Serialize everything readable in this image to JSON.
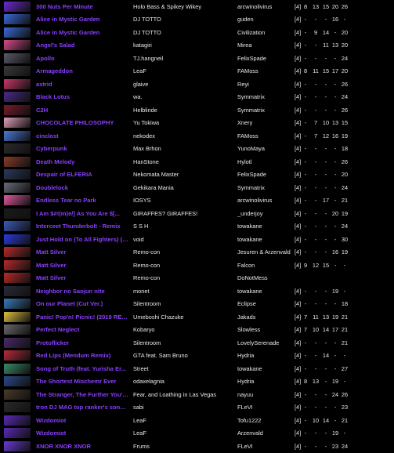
{
  "songs": [
    {
      "title": "300 Nuts Per Minute",
      "artist": "Holo Bass & Spikey Wikey",
      "charter": "arcwinolivirus",
      "level": "[4]",
      "d": [
        "8",
        "13",
        "15",
        "20",
        "26"
      ],
      "thumb": "#6a2bd0"
    },
    {
      "title": "Alice in Mystic Garden",
      "artist": "DJ TOTTO",
      "charter": "guden",
      "level": "[4]",
      "d": [
        "-",
        "-",
        "-",
        "16",
        "-"
      ],
      "thumb": "#3a6ad8"
    },
    {
      "title": "Alice in Mystic Garden",
      "artist": "DJ TOTTO",
      "charter": "Civilization",
      "level": "[4]",
      "d": [
        "-",
        "9",
        "14",
        "-",
        "20"
      ],
      "thumb": "#3a6ad8"
    },
    {
      "title": "Angel's Salad",
      "artist": "katagiri",
      "charter": "Mirea",
      "level": "[4]",
      "d": [
        "-",
        "-",
        "11",
        "13",
        "20"
      ],
      "thumb": "#d84a8a"
    },
    {
      "title": "Apollo",
      "artist": "TJ.hangneil",
      "charter": "FelixSpade",
      "level": "[4]",
      "d": [
        "-",
        "-",
        "-",
        "-",
        "24"
      ],
      "thumb": "#5a5a6a"
    },
    {
      "title": "Armageddon",
      "artist": "LeaF",
      "charter": "FAMoss",
      "level": "[4]",
      "d": [
        "8",
        "11",
        "15",
        "17",
        "20"
      ],
      "thumb": "#3a3a3a"
    },
    {
      "title": "astrid",
      "artist": "glaive",
      "charter": "Reyi",
      "level": "[4]",
      "d": [
        "-",
        "-",
        "-",
        "-",
        "26"
      ],
      "thumb": "#c8386a"
    },
    {
      "title": "Black Lotus",
      "artist": "wa.",
      "charter": "Symmatrix",
      "level": "[4]",
      "d": [
        "-",
        "-",
        "-",
        "-",
        "24"
      ],
      "thumb": "#4a2a8a"
    },
    {
      "title": "C2H",
      "artist": "Helblinde",
      "charter": "Symmatrix",
      "level": "[4]",
      "d": [
        "-",
        "-",
        "-",
        "-",
        "26"
      ],
      "thumb": "#7a1a2a"
    },
    {
      "title": "CHOCOLATE PHILOSOPHY",
      "artist": "Yu Tokiwa",
      "charter": "Xnery",
      "level": "[4]",
      "d": [
        "-",
        "7",
        "10",
        "13",
        "15"
      ],
      "thumb": "#e0a0b8"
    },
    {
      "title": "cinclost",
      "artist": "nekodex",
      "charter": "FAMoss",
      "level": "[4]",
      "d": [
        "-",
        "7",
        "12",
        "16",
        "19"
      ],
      "thumb": "#4a7ad8"
    },
    {
      "title": "Cyberpunk",
      "artist": "Max Brhon",
      "charter": "YunoMaya",
      "level": "[4]",
      "d": [
        "-",
        "-",
        "-",
        "-",
        "18"
      ],
      "thumb": "#2a2a2a"
    },
    {
      "title": "Death Melody",
      "artist": "HanStone",
      "charter": "Hylotl",
      "level": "[4]",
      "d": [
        "-",
        "-",
        "-",
        "-",
        "26"
      ],
      "thumb": "#8a3a2a"
    },
    {
      "title": "Despair of ELFERIA",
      "artist": "Nekomata Master",
      "charter": "FelixSpade",
      "level": "[4]",
      "d": [
        "-",
        "-",
        "-",
        "-",
        "20"
      ],
      "thumb": "#2a3a5a"
    },
    {
      "title": "Doublelock",
      "artist": "Gekikara Mania",
      "charter": "Symmatrix",
      "level": "[4]",
      "d": [
        "-",
        "-",
        "-",
        "-",
        "24"
      ],
      "thumb": "#6a6a7a"
    },
    {
      "title": "Endless Tear no Park",
      "artist": "IOSYS",
      "charter": "arcwinolivirus",
      "level": "[4]",
      "d": [
        "-",
        "-",
        "17",
        "-",
        "21"
      ],
      "thumb": "#e05aa0"
    },
    {
      "title": "I Am $#!(m)e/] As You Are $[...",
      "artist": "GIRAFFES? GIRAFFES!",
      "charter": "_underjoy",
      "level": "[4]",
      "d": [
        "-",
        "-",
        "-",
        "20",
        "19"
      ],
      "thumb": "#1a1a1a"
    },
    {
      "title": "Interceet Thunderbolt - Remix",
      "artist": "S S H",
      "charter": "towakane",
      "level": "[4]",
      "d": [
        "-",
        "-",
        "-",
        "-",
        "24"
      ],
      "thumb": "#3a5ab8"
    },
    {
      "title": "Just Hold on (To All Fighters) (C...",
      "artist": "void",
      "charter": "towakane",
      "level": "[4]",
      "d": [
        "-",
        "-",
        "-",
        "-",
        "30"
      ],
      "thumb": "#2a3ae0"
    },
    {
      "title": "Matt Silver",
      "artist": "Remo-con",
      "charter": "Jesuren & Arzenvald",
      "level": "[4]",
      "d": [
        "-",
        "-",
        "-",
        "16",
        "19"
      ],
      "thumb": "#b82a2a"
    },
    {
      "title": "Matt Silver",
      "artist": "Remo-con",
      "charter": "Falcon",
      "level": "[4]",
      "d": [
        "9",
        "12",
        "15",
        "-",
        "-"
      ],
      "thumb": "#b82a2a"
    },
    {
      "title": "Matt Silver",
      "artist": "Remo-con",
      "charter": "DoNotMess",
      "level": "",
      "d": [
        "",
        "",
        "",
        "",
        ""
      ],
      "thumb": "#b82a2a"
    },
    {
      "title": "Neighbor no Saojun nite",
      "artist": "monet",
      "charter": "towakane",
      "level": "[4]",
      "d": [
        "-",
        "-",
        "-",
        "19",
        "-"
      ],
      "thumb": "#2a2a3a"
    },
    {
      "title": "On our Planet (Cut Ver.)",
      "artist": "Silentroom",
      "charter": "Eclipse",
      "level": "[4]",
      "d": [
        "-",
        "-",
        "-",
        "-",
        "18"
      ],
      "thumb": "#3a7ab8"
    },
    {
      "title": "Panic! Pop'n! Picnic! (2019 REM...",
      "artist": "Umeboshi Chazuke",
      "charter": "Jakads",
      "level": "[4]",
      "d": [
        "7",
        "11",
        "13",
        "19",
        "21"
      ],
      "thumb": "#e0c040"
    },
    {
      "title": "Perfect Neglect",
      "artist": "Kobaryo",
      "charter": "Slowless",
      "level": "[4]",
      "d": [
        "7",
        "10",
        "14",
        "17",
        "21"
      ],
      "thumb": "#6a6a6a"
    },
    {
      "title": "Protoflicker",
      "artist": "Silentroom",
      "charter": "LovelySerenade",
      "level": "[4]",
      "d": [
        "-",
        "-",
        "-",
        "-",
        "21"
      ],
      "thumb": "#4a2a6a"
    },
    {
      "title": "Red Lips (Mendum Remix)",
      "artist": "GTA feat. Sam Bruno",
      "charter": "Hydria",
      "level": "[4]",
      "d": [
        "-",
        "-",
        "14",
        "-",
        "-"
      ],
      "thumb": "#b82a3a"
    },
    {
      "title": "Song of Truth (feat. Yurisha Er...",
      "artist": "Street",
      "charter": "towakane",
      "level": "[4]",
      "d": [
        "-",
        "-",
        "-",
        "-",
        "27"
      ],
      "thumb": "#3a8a6a"
    },
    {
      "title": "The Shortest Mischemr Ever",
      "artist": "odaxelagnia",
      "charter": "Hydria",
      "level": "[4]",
      "d": [
        "8",
        "13",
        "-",
        "19",
        "-"
      ],
      "thumb": "#2a4a8a"
    },
    {
      "title": "The Stranger, The Further You'll...",
      "artist": "Fear, and Loathing in Las Vegas",
      "charter": "nayuu",
      "level": "[4]",
      "d": [
        "-",
        "-",
        "-",
        "24",
        "26"
      ],
      "thumb": "#4a3a2a"
    },
    {
      "title": "tron DJ MAG top ranker's song Z...",
      "artist": "sabi",
      "charter": "FLeVI",
      "level": "[4]",
      "d": [
        "-",
        "-",
        "-",
        "-",
        "23"
      ],
      "thumb": "#2a2a2a"
    },
    {
      "title": "Wizdomiot",
      "artist": "LeaF",
      "charter": "Tofu1222",
      "level": "[4]",
      "d": [
        "-",
        "10",
        "14",
        "-",
        "21"
      ],
      "thumb": "#5a2ab8"
    },
    {
      "title": "Wizdomiot",
      "artist": "LeaF",
      "charter": "Arzenvald",
      "level": "[4]",
      "d": [
        "-",
        "-",
        "-",
        "19",
        "-"
      ],
      "thumb": "#5a2ab8"
    },
    {
      "title": "XNOR XNOR XNOR",
      "artist": "Frums",
      "charter": "FLeVI",
      "level": "[4]",
      "d": [
        "-",
        "-",
        "-",
        "23",
        "24"
      ],
      "thumb": "#6a3ad8"
    }
  ]
}
